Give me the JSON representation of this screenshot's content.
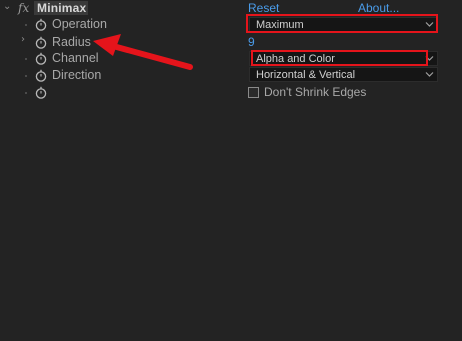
{
  "effect": {
    "fx_glyph": "fx",
    "name": "Minimax",
    "reset_label": "Reset",
    "about_label": "About..."
  },
  "properties": [
    {
      "label": "Operation",
      "value": "Maximum"
    },
    {
      "label": "Radius",
      "value": "9"
    },
    {
      "label": "Channel",
      "value": "Alpha and Color"
    },
    {
      "label": "Direction",
      "value": "Horizontal & Vertical"
    }
  ],
  "checkbox": {
    "label": "Don't Shrink Edges",
    "checked": false
  },
  "colors": {
    "background": "#232323",
    "link": "#4a9be8",
    "highlight": "#e5141b"
  }
}
